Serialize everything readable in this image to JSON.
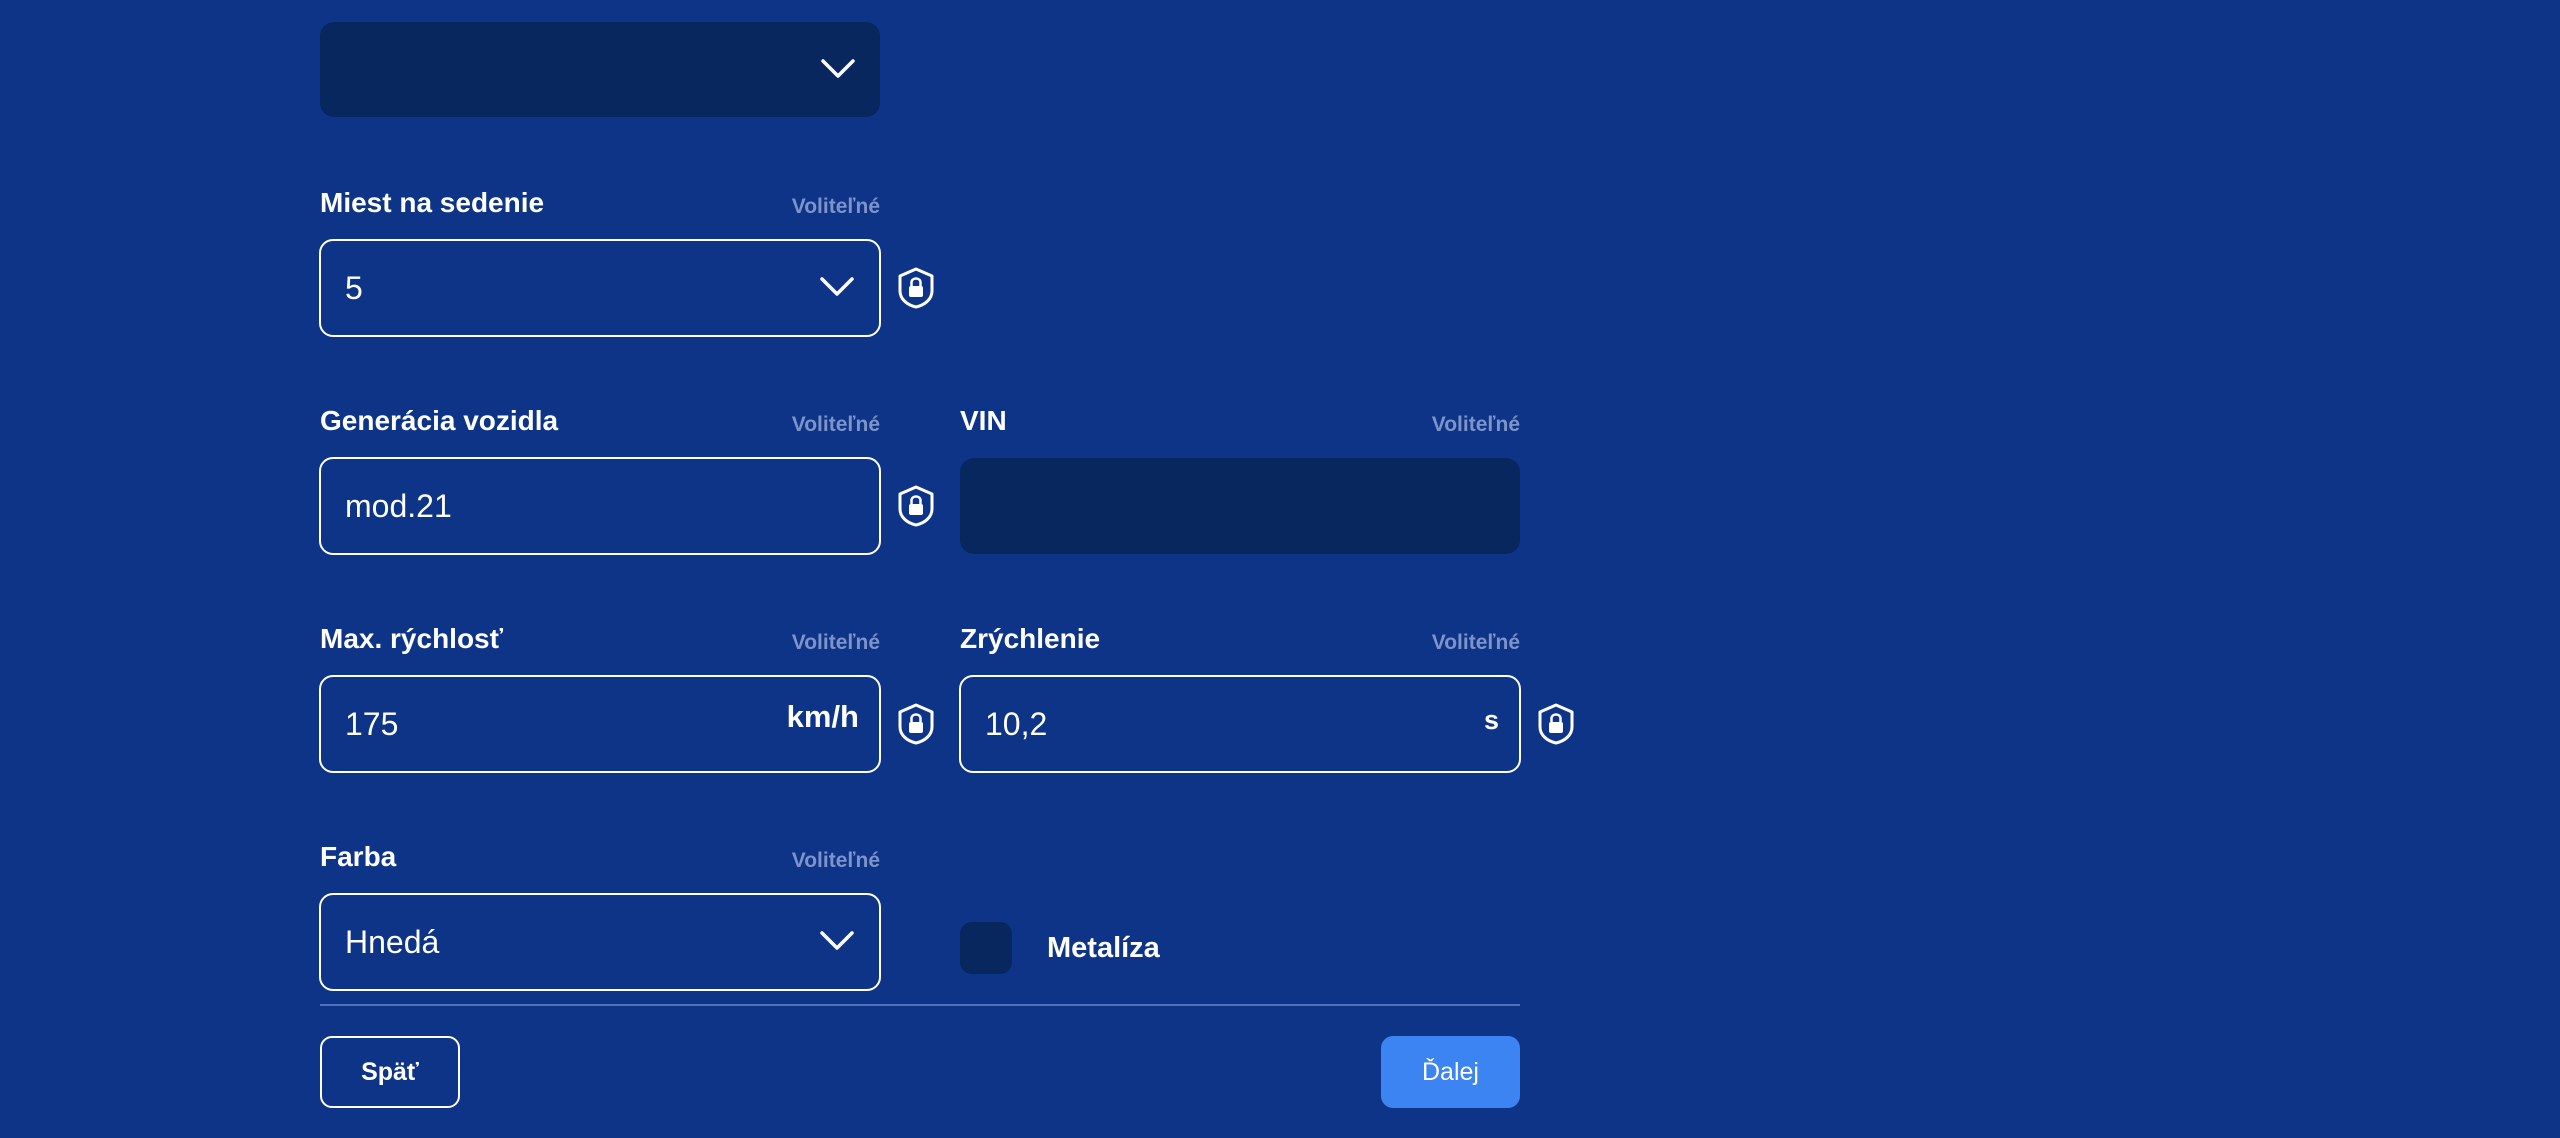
{
  "top_select": {
    "value": ""
  },
  "optional_label": "Voliteľné",
  "seats": {
    "label": "Miest na sedenie",
    "optional": "Voliteľné",
    "value": "5"
  },
  "generation": {
    "label": "Generácia vozidla",
    "optional": "Voliteľné",
    "value": "mod.21"
  },
  "vin": {
    "label": "VIN",
    "optional": "Voliteľné",
    "value": ""
  },
  "max_speed": {
    "label": "Max. rýchlosť",
    "optional": "Voliteľné",
    "value": "175",
    "unit": "km/h"
  },
  "acceleration": {
    "label": "Zrýchlenie",
    "optional": "Voliteľné",
    "value": "10,2",
    "unit": "s"
  },
  "color": {
    "label": "Farba",
    "optional": "Voliteľné",
    "value": "Hnedá"
  },
  "metallic": {
    "label": "Metalíza",
    "checked": false
  },
  "buttons": {
    "back": "Späť",
    "next": "Ďalej"
  },
  "icons": {
    "chevron": "chevron-down-icon",
    "lock": "shield-lock-icon"
  },
  "colors": {
    "background": "#0d3487",
    "field_filled": "#08275f",
    "optional_text": "#7d93c9",
    "primary_button": "#3b84f1"
  }
}
